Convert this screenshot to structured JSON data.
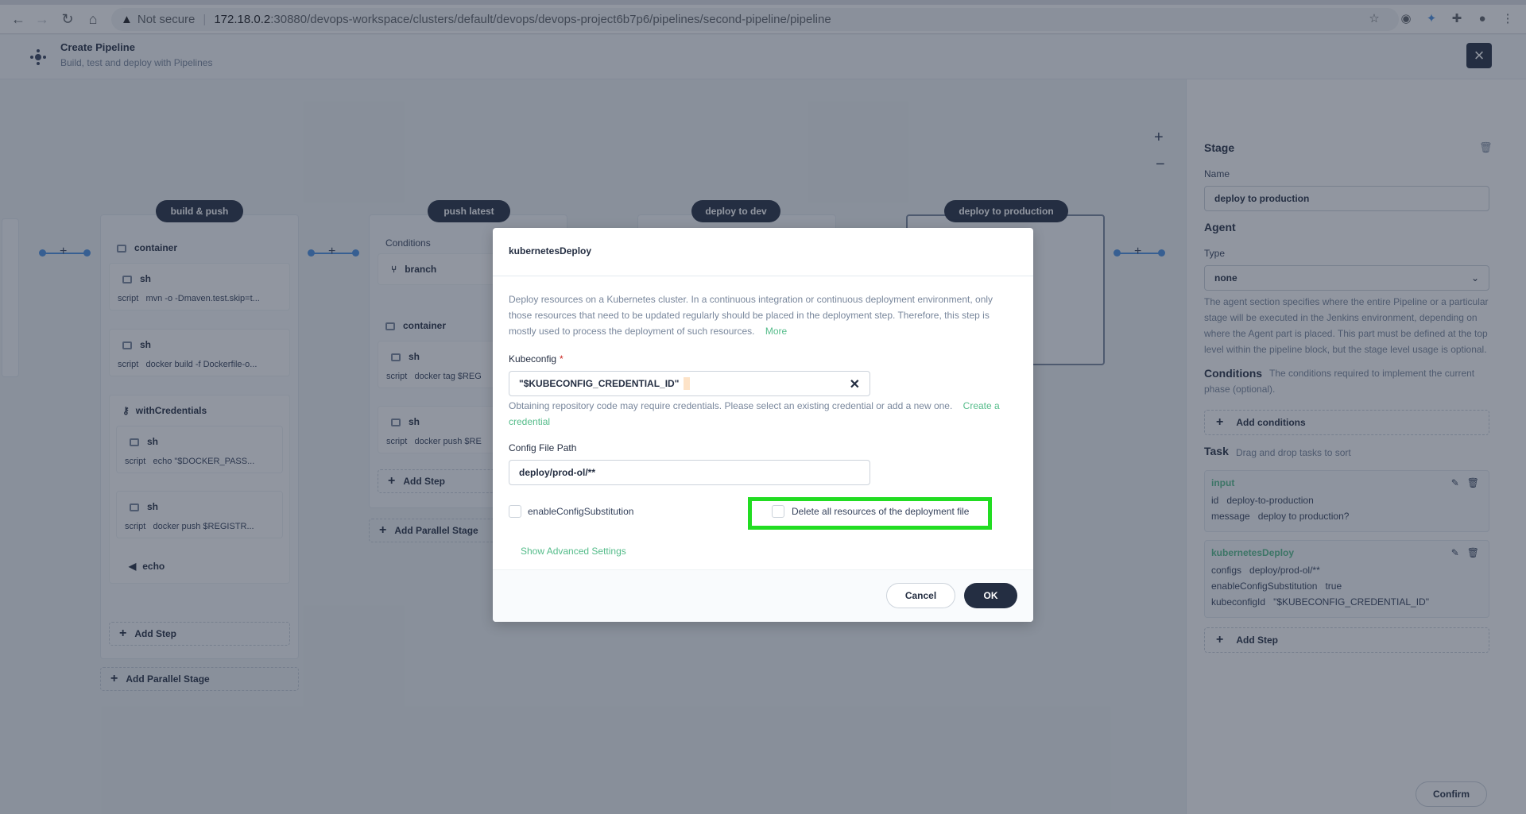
{
  "browser": {
    "security": "Not secure",
    "url_host": "172.18.0.2",
    "url_rest": ":30880/devops-workspace/clusters/default/devops/devops-project6b7p6/pipelines/second-pipeline/pipeline"
  },
  "header": {
    "title": "Create Pipeline",
    "subtitle": "Build, test and deploy with Pipelines"
  },
  "stages": {
    "build_push": {
      "label": "build & push",
      "container": "container",
      "steps": [
        {
          "title": "sh",
          "script_key": "script",
          "script": "mvn -o -Dmaven.test.skip=t..."
        },
        {
          "title": "sh",
          "script_key": "script",
          "script": "docker build -f Dockerfile-o..."
        },
        {
          "title": "withCredentials"
        },
        {
          "title": "sh",
          "script_key": "script",
          "script": "echo \"$DOCKER_PASS..."
        },
        {
          "title": "sh",
          "script_key": "script",
          "script": "docker push $REGISTR..."
        },
        {
          "title": "echo"
        }
      ],
      "add_step": "Add Step",
      "add_parallel": "Add Parallel Stage"
    },
    "push_latest": {
      "label": "push latest",
      "conditions": "Conditions",
      "branch": "branch",
      "container": "container",
      "steps": [
        {
          "title": "sh",
          "script_key": "script",
          "script": "docker tag $REG"
        },
        {
          "title": "sh",
          "script_key": "script",
          "script": "docker push $RE"
        }
      ],
      "add_step": "Add Step",
      "add_parallel": "Add Parallel Stage"
    },
    "deploy_dev": {
      "label": "deploy to dev"
    },
    "deploy_prod": {
      "label": "deploy to production"
    }
  },
  "panel": {
    "stage_title": "Stage",
    "name_label": "Name",
    "name_value": "deploy to production",
    "agent_title": "Agent",
    "type_label": "Type",
    "type_value": "none",
    "agent_desc": "The agent section specifies where the entire Pipeline or a particular stage will be executed in the Jenkins environment, depending on where the Agent part is placed. This part must be defined at the top level within the pipeline block, but the stage level usage is optional.",
    "conditions_title": "Conditions",
    "conditions_desc": "The conditions required to implement the current phase (optional).",
    "add_conditions": "Add conditions",
    "task_title": "Task",
    "task_desc": "Drag and drop tasks to sort",
    "tasks": [
      {
        "name": "input",
        "rows": [
          {
            "k": "id",
            "v": "deploy-to-production"
          },
          {
            "k": "message",
            "v": "deploy to production?"
          }
        ]
      },
      {
        "name": "kubernetesDeploy",
        "rows": [
          {
            "k": "configs",
            "v": "deploy/prod-ol/**"
          },
          {
            "k": "enableConfigSubstitution",
            "v": "true"
          },
          {
            "k": "kubeconfigId",
            "v": "\"$KUBECONFIG_CREDENTIAL_ID\""
          }
        ]
      }
    ],
    "add_step": "Add Step",
    "confirm": "Confirm"
  },
  "modal": {
    "title": "kubernetesDeploy",
    "desc": "Deploy resources on a Kubernetes cluster. In a continuous integration or continuous deployment environment, only those resources that need to be updated regularly should be placed in the deployment step. Therefore, this step is mostly used to process the deployment of such resources.",
    "more": "More",
    "kubeconfig_label": "Kubeconfig",
    "kubeconfig_value": "\"$KUBECONFIG_CREDENTIAL_ID\"",
    "kubeconfig_help": "Obtaining repository code may require credentials. Please select an existing credential or add a new one.",
    "create_credential": "Create a credential",
    "config_path_label": "Config File Path",
    "config_path_value": "deploy/prod-ol/**",
    "enable_substitution": "enableConfigSubstitution",
    "delete_all": "Delete all resources of the deployment file",
    "advanced": "Show Advanced Settings",
    "cancel": "Cancel",
    "ok": "OK"
  },
  "colors": {
    "accent": "#55bc8a",
    "dark": "#242e42",
    "highlight": "#22dd22"
  }
}
